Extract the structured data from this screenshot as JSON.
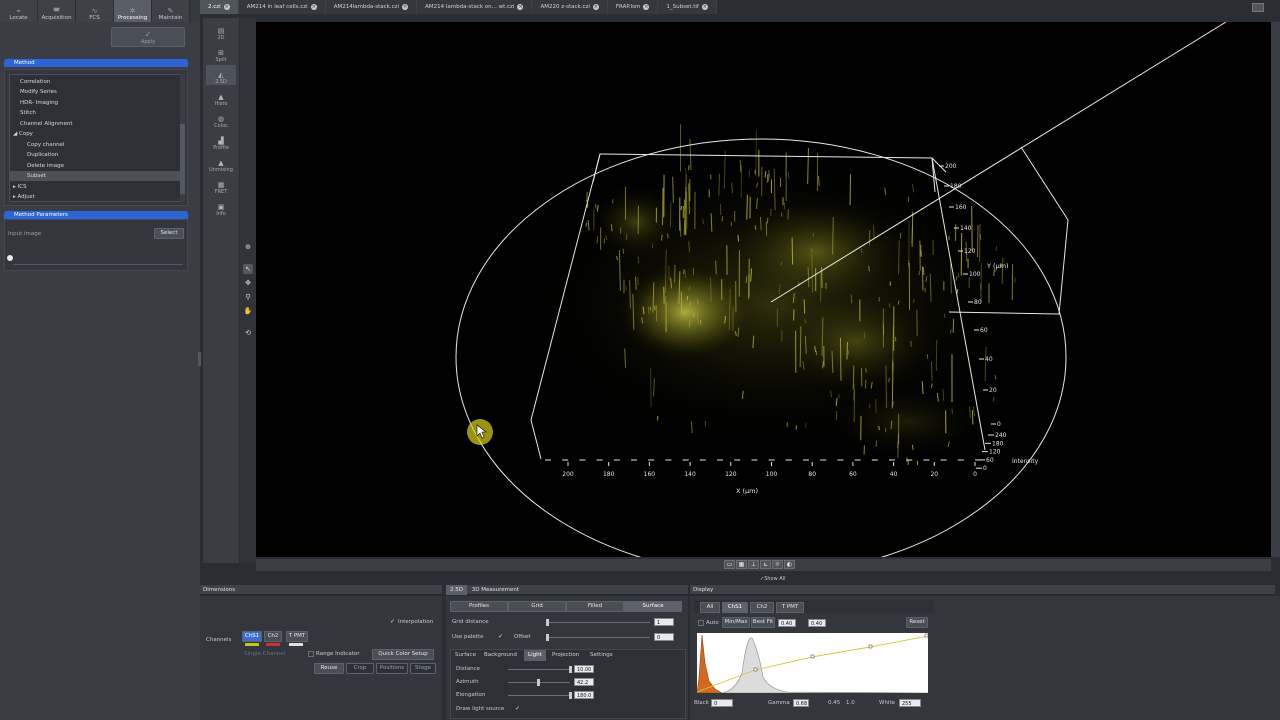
{
  "top_tabs": [
    {
      "label": "Locate",
      "icon": "binoculars-icon"
    },
    {
      "label": "Acquisition",
      "icon": "camera-icon"
    },
    {
      "label": "FCS",
      "icon": "fcs-icon"
    },
    {
      "label": "Processing",
      "icon": "gear-icon"
    },
    {
      "label": "Maintain",
      "icon": "wrench-icon"
    }
  ],
  "active_top_tab": "Processing",
  "apply_label": "Apply",
  "method": {
    "header": "Method",
    "items": [
      "Correlation",
      "Modify Series",
      "HDR- Imaging",
      "Stitch",
      "Channel Alignment",
      "Copy",
      "Copy channel",
      "Duplication",
      "Delete image",
      "Subset",
      "ICS",
      "Adjust"
    ],
    "selected": "Subset"
  },
  "params": {
    "header": "Method Parameters",
    "input_label": "Input image",
    "select_label": "Select"
  },
  "view_tabs": [
    "2.czi",
    "AM214 in leaf cells.czi",
    "AM214lambda-stack.czi",
    "AM214 lambda-stack on... wt.czi",
    "AM220 z-stack.czi",
    "FRAP.lsm",
    "1_Subset.tif"
  ],
  "side_views": [
    "2D",
    "Split",
    "2.5D",
    "Histo",
    "Coloc",
    "Profile",
    "Unmixing",
    "FRET",
    "Info"
  ],
  "active_view": "2.5D",
  "plot_axes": {
    "y_ticks": [
      "200",
      "180",
      "160",
      "140",
      "120",
      "100",
      "80",
      "60",
      "40",
      "20",
      "0"
    ],
    "y_label": "Y (µm)",
    "x_ticks": [
      "200",
      "180",
      "160",
      "140",
      "120",
      "100",
      "80",
      "60",
      "40",
      "20",
      "0"
    ],
    "x_label": "X (µm)",
    "z_ticks": [
      "240",
      "180",
      "120",
      "60",
      "0"
    ],
    "z_label": "Intensity"
  },
  "show_all_label": "Show All",
  "dimensions": {
    "header": "Dimensions",
    "interpolation": "Interpolation",
    "channels_label": "Channels",
    "ch1": "ChS1",
    "ch2": "Ch2",
    "ch3": "T PMT",
    "single_channel": "Single Channel",
    "range_indicator": "Range Indicator",
    "quick_color": "Quick Color Setup",
    "reuse": "Reuse",
    "crop": "Crop",
    "positions": "Positions",
    "stage": "Stage"
  },
  "render_panel": {
    "tab1": "2.5D",
    "tab2": "3D Measurement",
    "modes": [
      "Profiles",
      "Grid",
      "Filled",
      "Surface"
    ],
    "active_mode": "Surface",
    "grid_distance_label": "Grid distance",
    "grid_distance": "1",
    "use_palette": "Use palette",
    "offset_label": "Offset",
    "offset": "0",
    "subtabs": [
      "Surface",
      "Background",
      "Light",
      "Projection",
      "Settings"
    ],
    "active_subtab": "Light",
    "distance_label": "Distance",
    "distance": "10.00",
    "azimuth_label": "Azimuth",
    "azimuth": "42.2",
    "elongation_label": "Elongation",
    "elongation": "180.0",
    "draw_light": "Draw light source"
  },
  "display": {
    "header": "Display",
    "tabs": [
      "All",
      "ChS1",
      "Ch2",
      "T PMT"
    ],
    "active_tab": "ChS1",
    "auto": "Auto",
    "minmax": "Min/Max",
    "bestfit": "Best Fit",
    "bf1": "0.40",
    "bf2": "0.40",
    "reset": "Reset",
    "black_label": "Black",
    "black": "0",
    "gamma_label": "Gamma",
    "gamma": "0.68",
    "g2": "0.45",
    "g3": "1.0",
    "white_label": "White",
    "white": "255"
  }
}
